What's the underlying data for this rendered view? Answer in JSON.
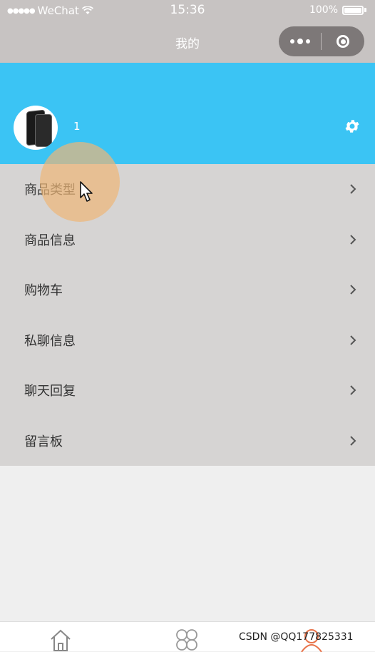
{
  "status_bar": {
    "carrier": "WeChat",
    "time": "15:36",
    "battery": "100%"
  },
  "nav": {
    "title": "我的"
  },
  "profile": {
    "username": "1"
  },
  "menu": [
    {
      "label": "商品类型"
    },
    {
      "label": "商品信息"
    },
    {
      "label": "购物车"
    },
    {
      "label": "私聊信息"
    },
    {
      "label": "聊天回复"
    },
    {
      "label": "留言板"
    }
  ],
  "watermark": "CSDN @QQ177825331",
  "colors": {
    "header_bg": "#c7c3c2",
    "profile_bg": "#3bc4f4",
    "menu_bg": "#d6d4d3",
    "active_tab": "#e8734a"
  },
  "tab_icons": [
    "home-icon",
    "category-icon",
    "user-icon"
  ]
}
